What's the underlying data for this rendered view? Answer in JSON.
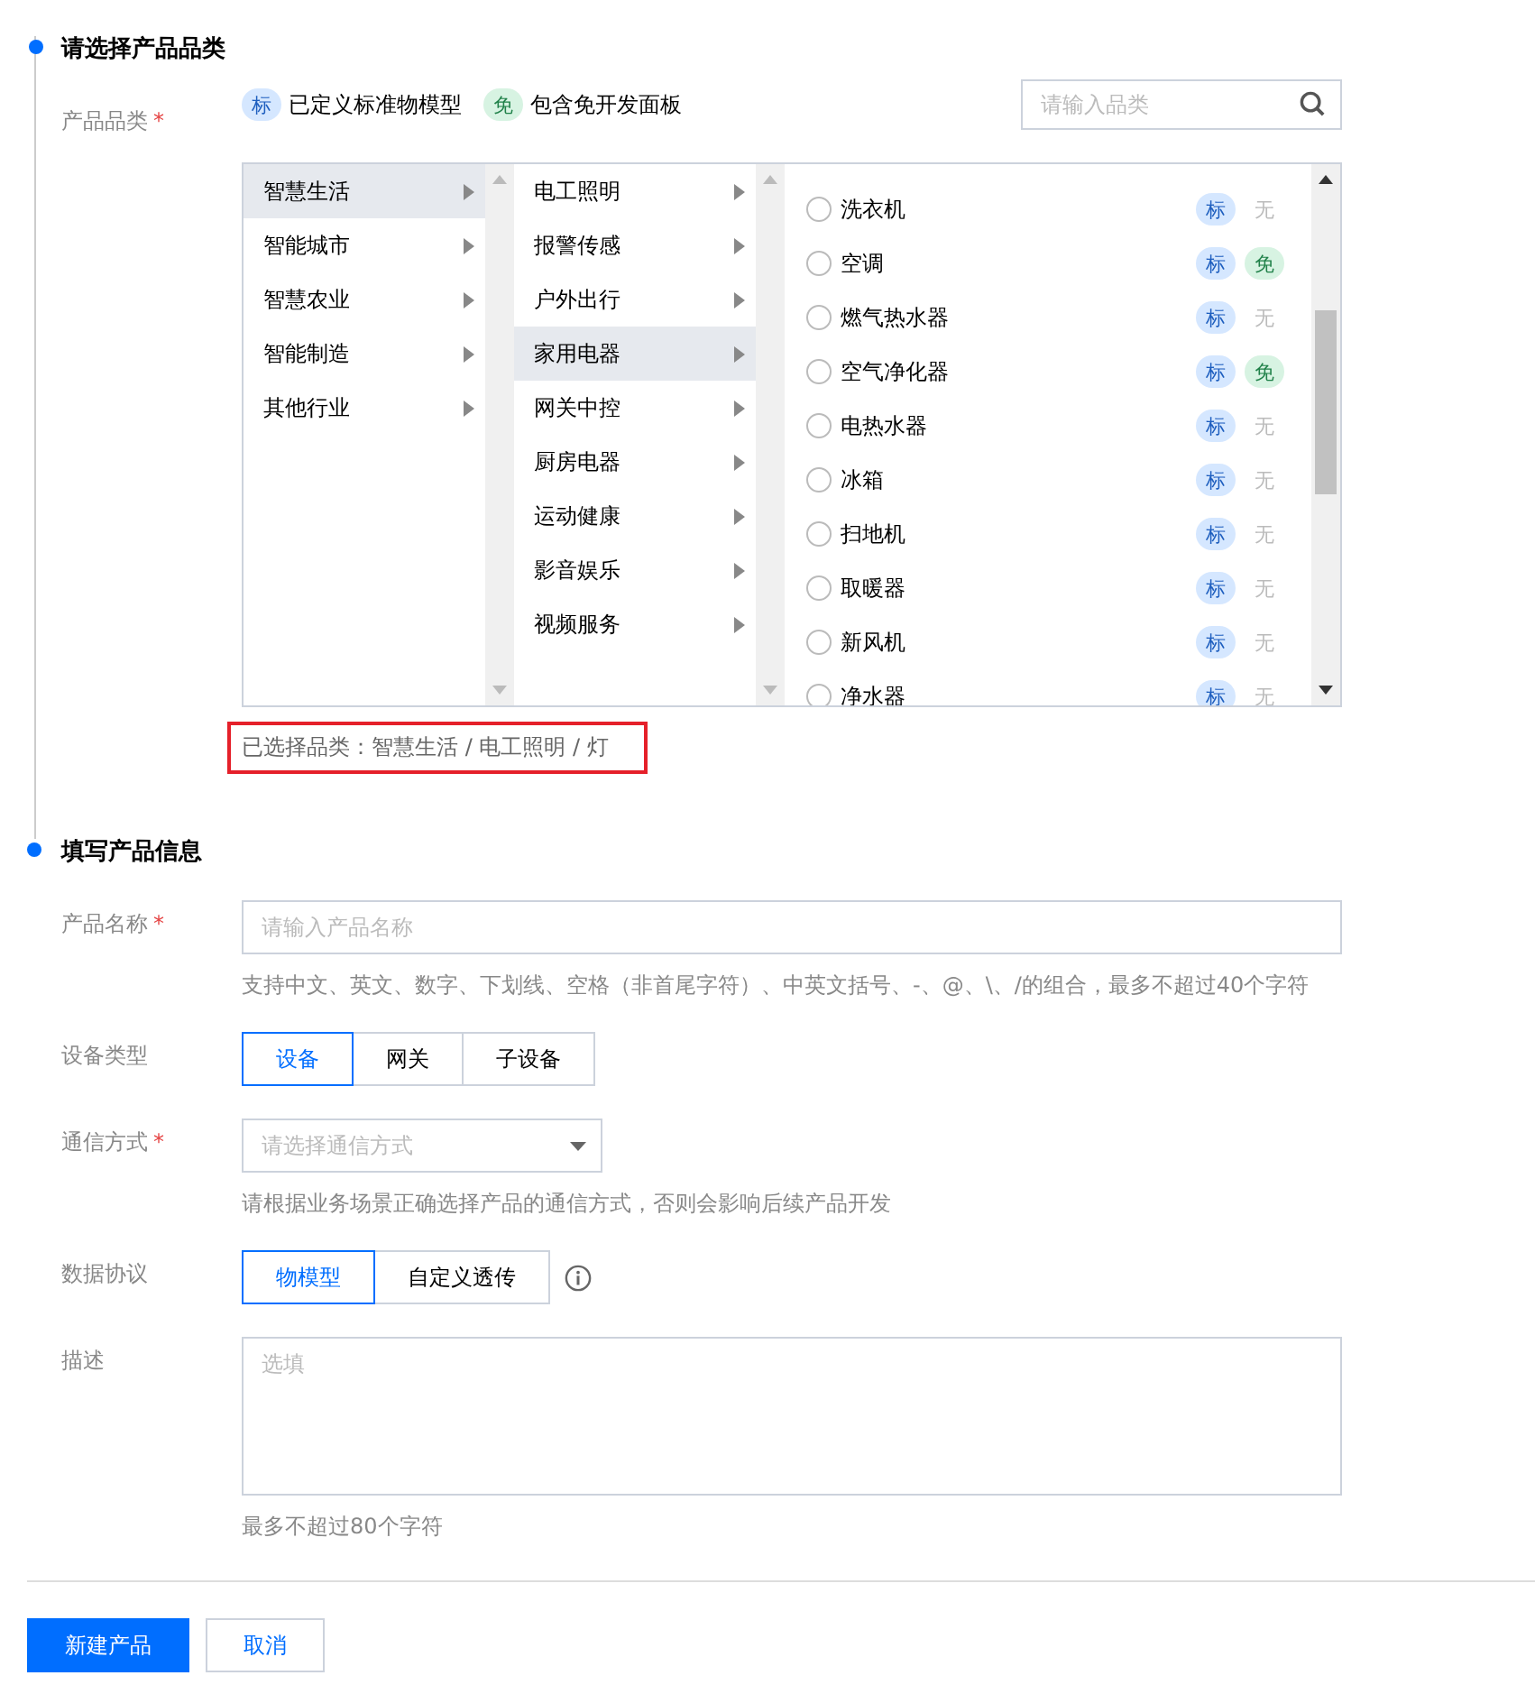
{
  "category_section": {
    "title": "请选择产品品类",
    "label": "产品品类",
    "required_mark": "*",
    "legend": [
      {
        "badge": "标",
        "kind": "std",
        "text": "已定义标准物模型"
      },
      {
        "badge": "免",
        "kind": "free",
        "text": "包含免开发面板"
      }
    ],
    "search": {
      "placeholder": "请输入品类"
    },
    "columns": [
      {
        "items": [
          {
            "label": "智慧生活",
            "selected": true
          },
          {
            "label": "智能城市",
            "selected": false
          },
          {
            "label": "智慧农业",
            "selected": false
          },
          {
            "label": "智能制造",
            "selected": false
          },
          {
            "label": "其他行业",
            "selected": false
          }
        ]
      },
      {
        "items": [
          {
            "label": "电工照明",
            "selected": false
          },
          {
            "label": "报警传感",
            "selected": false
          },
          {
            "label": "户外出行",
            "selected": false
          },
          {
            "label": "家用电器",
            "selected": true
          },
          {
            "label": "网关中控",
            "selected": false
          },
          {
            "label": "厨房电器",
            "selected": false
          },
          {
            "label": "运动健康",
            "selected": false
          },
          {
            "label": "影音娱乐",
            "selected": false
          },
          {
            "label": "视频服务",
            "selected": false
          }
        ]
      }
    ],
    "products": [
      {
        "name": "洗衣机",
        "selected": false,
        "tags": [
          {
            "text": "标",
            "kind": "std"
          },
          {
            "text": "无",
            "kind": "none"
          }
        ]
      },
      {
        "name": "空调",
        "selected": false,
        "tags": [
          {
            "text": "标",
            "kind": "std"
          },
          {
            "text": "免",
            "kind": "free"
          }
        ]
      },
      {
        "name": "燃气热水器",
        "selected": false,
        "tags": [
          {
            "text": "标",
            "kind": "std"
          },
          {
            "text": "无",
            "kind": "none"
          }
        ]
      },
      {
        "name": "空气净化器",
        "selected": false,
        "tags": [
          {
            "text": "标",
            "kind": "std"
          },
          {
            "text": "免",
            "kind": "free"
          }
        ]
      },
      {
        "name": "电热水器",
        "selected": false,
        "tags": [
          {
            "text": "标",
            "kind": "std"
          },
          {
            "text": "无",
            "kind": "none"
          }
        ]
      },
      {
        "name": "冰箱",
        "selected": false,
        "tags": [
          {
            "text": "标",
            "kind": "std"
          },
          {
            "text": "无",
            "kind": "none"
          }
        ]
      },
      {
        "name": "扫地机",
        "selected": false,
        "tags": [
          {
            "text": "标",
            "kind": "std"
          },
          {
            "text": "无",
            "kind": "none"
          }
        ]
      },
      {
        "name": "取暖器",
        "selected": false,
        "tags": [
          {
            "text": "标",
            "kind": "std"
          },
          {
            "text": "无",
            "kind": "none"
          }
        ]
      },
      {
        "name": "新风机",
        "selected": false,
        "tags": [
          {
            "text": "标",
            "kind": "std"
          },
          {
            "text": "无",
            "kind": "none"
          }
        ]
      },
      {
        "name": "净水器",
        "selected": false,
        "tags": [
          {
            "text": "标",
            "kind": "std"
          },
          {
            "text": "无",
            "kind": "none"
          }
        ]
      }
    ],
    "selected_path": "已选择品类：智慧生活 / 电工照明 / 灯"
  },
  "info_section": {
    "title": "填写产品信息",
    "name_field": {
      "label": "产品名称",
      "required_mark": "*",
      "placeholder": "请输入产品名称",
      "hint": "支持中文、英文、数字、下划线、空格（非首尾字符）、中英文括号、-、@、\\、/的组合，最多不超过40个字符"
    },
    "device_type": {
      "label": "设备类型",
      "options": [
        {
          "label": "设备",
          "selected": true
        },
        {
          "label": "网关",
          "selected": false
        },
        {
          "label": "子设备",
          "selected": false
        }
      ]
    },
    "comm": {
      "label": "通信方式",
      "required_mark": "*",
      "placeholder": "请选择通信方式",
      "hint": "请根据业务场景正确选择产品的通信方式，否则会影响后续产品开发"
    },
    "protocol": {
      "label": "数据协议",
      "options": [
        {
          "label": "物模型",
          "selected": true
        },
        {
          "label": "自定义透传",
          "selected": false
        }
      ]
    },
    "description": {
      "label": "描述",
      "placeholder": "选填",
      "hint": "最多不超过80个字符"
    }
  },
  "buttons": [
    {
      "label": "新建产品",
      "kind": "primary"
    },
    {
      "label": "取消",
      "kind": "secondary"
    }
  ]
}
